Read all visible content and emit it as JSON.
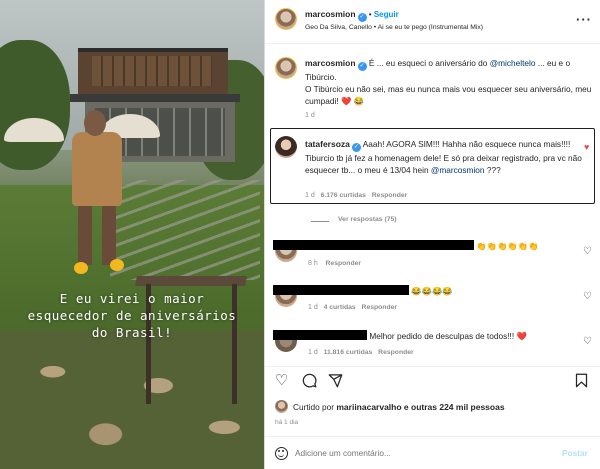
{
  "post": {
    "username": "marcosmion",
    "follow_label": "Seguir",
    "subtitle": "Geo Da Silva, Canello • Ai se eu te pego (Instrumental Mix)",
    "more_icon": "more-horizontal-icon"
  },
  "media": {
    "overlay_text": "E eu virei o maior\nesquecedor de aniversários\ndo Brasil!"
  },
  "caption": {
    "username": "marcosmion",
    "line1_pre": "É ... eu esqueci o aniversário do ",
    "mention": "@micheltelo",
    "line1_post": " ... eu e o Tibúrcio.",
    "line2": "O Tibúrcio eu não sei, mas eu nunca mais vou esquecer seu aniversário, meu cumpadi! ❤️ 😂",
    "time": "1 d"
  },
  "highlighted_comment": {
    "username": "tatafersoza",
    "text": "Aaah! AGORA SIM!!! Hahha não esquece nunca mais!!!! Tiburcio tb já fez a homenagem dele! E só pra deixar registrado, pra vc não esquecer tb... o meu é 13/04 hein ",
    "mention": "@marcosmion",
    "text_end": " ???",
    "time": "1 d",
    "likes": "6.176 curtidas",
    "reply": "Responder",
    "view_replies": "Ver respostas (75)"
  },
  "comments": [
    {
      "text": "👏👏👏👏👏👏",
      "time": "8 h",
      "likes": "",
      "reply": "Responder"
    },
    {
      "text": "😂😂😂😂",
      "time": "1 d",
      "likes": "4 curtidas",
      "reply": "Responder"
    },
    {
      "text": "Melhor pedido de desculpas de todos!!! ❤️",
      "time": "1 d",
      "likes": "11.816 curtidas",
      "reply": "Responder"
    }
  ],
  "likes_line": {
    "prefix": "Curtido por ",
    "user": "mariinacarvalho",
    "suffix": " e outras 224 mil pessoas"
  },
  "post_time": "há 1 dia",
  "add_comment": {
    "placeholder": "Adicione um comentário...",
    "post_label": "Postar"
  },
  "colors": {
    "link_blue": "#0095f6",
    "verified_blue": "#3897f0",
    "heart_red": "#ed4956"
  }
}
